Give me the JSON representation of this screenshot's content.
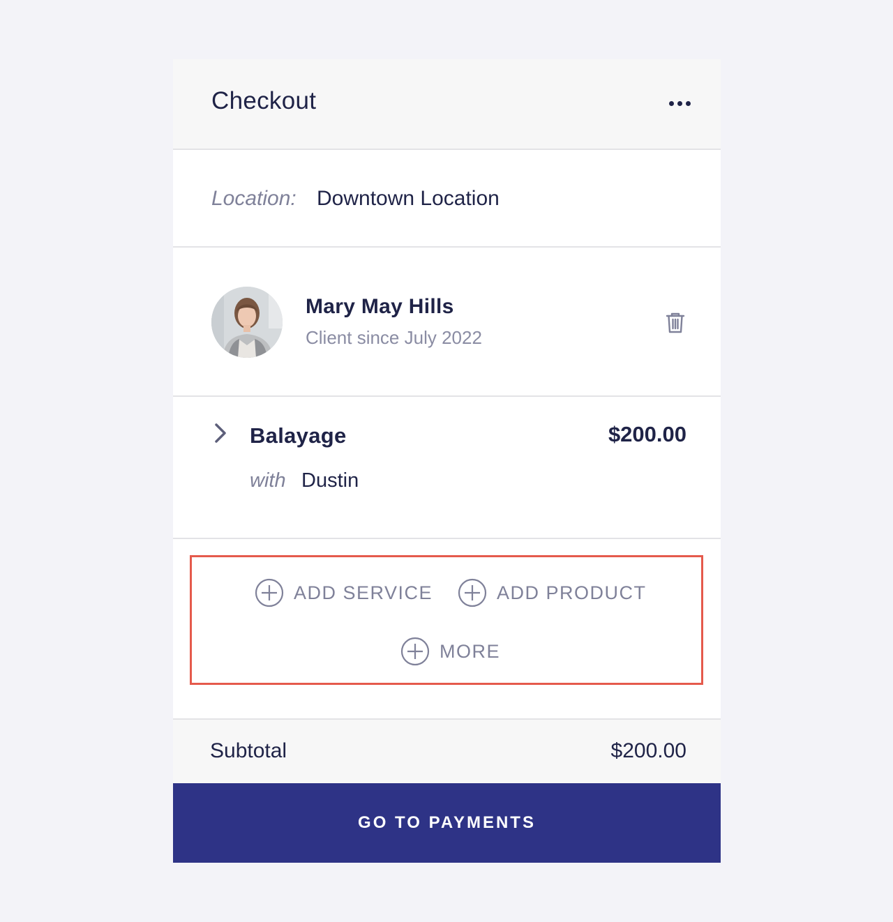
{
  "header": {
    "title": "Checkout",
    "menu_icon": "more-horizontal-icon"
  },
  "location": {
    "label": "Location:",
    "value": "Downtown Location"
  },
  "client": {
    "name": "Mary May Hills",
    "since": "Client since July 2022",
    "avatar": "client-photo",
    "delete_icon": "trash-icon"
  },
  "service": {
    "expand_icon": "chevron-right-icon",
    "name": "Balayage",
    "price": "$200.00",
    "with_label": "with",
    "staff": "Dustin"
  },
  "actions": {
    "add_service": "ADD SERVICE",
    "add_product": "ADD PRODUCT",
    "more": "MORE",
    "icon": "plus-circle-icon"
  },
  "summary": {
    "subtotal_label": "Subtotal",
    "subtotal_value": "$200.00"
  },
  "footer": {
    "pay_label": "GO TO PAYMENTS"
  },
  "colors": {
    "background": "#f3f3f8",
    "primary": "#2e3386",
    "text": "#1f2347",
    "muted": "#7f8199",
    "highlight_border": "#e55a4c"
  }
}
